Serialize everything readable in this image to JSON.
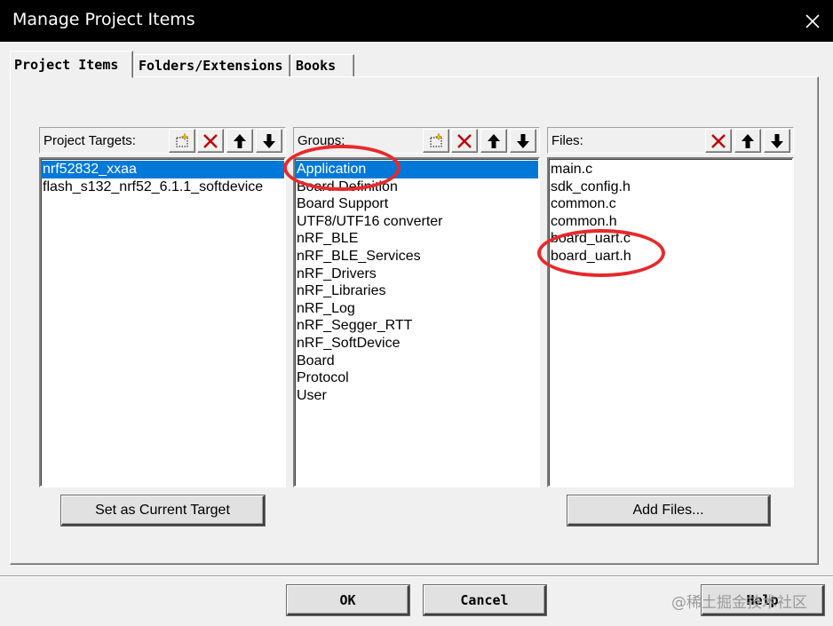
{
  "window": {
    "title": "Manage Project Items"
  },
  "tabs": [
    {
      "label": "Project Items",
      "active": true
    },
    {
      "label": "Folders/Extensions",
      "active": false
    },
    {
      "label": "Books",
      "active": false
    }
  ],
  "targets": {
    "title": "Project Targets:",
    "items": [
      "nrf52832_xxaa",
      "flash_s132_nrf52_6.1.1_softdevice"
    ],
    "selected_index": 0,
    "button_label": "Set as Current Target"
  },
  "groups": {
    "title": "Groups:",
    "items": [
      "Application",
      "Board Definition",
      "Board Support",
      "UTF8/UTF16 converter",
      "nRF_BLE",
      "nRF_BLE_Services",
      "nRF_Drivers",
      "nRF_Libraries",
      "nRF_Log",
      "nRF_Segger_RTT",
      "nRF_SoftDevice",
      "Board",
      "Protocol",
      "User"
    ],
    "selected_index": 0
  },
  "files": {
    "title": "Files:",
    "items": [
      "main.c",
      "sdk_config.h",
      "common.c",
      "common.h",
      "board_uart.c",
      "board_uart.h"
    ],
    "button_label": "Add Files..."
  },
  "footer": {
    "ok": "OK",
    "cancel": "Cancel",
    "help": "Help"
  },
  "watermark": "@稀土掘金技术社区",
  "colors": {
    "selection": "#0078d7",
    "annotation": "#e8292b",
    "titlebar": "#000000"
  }
}
